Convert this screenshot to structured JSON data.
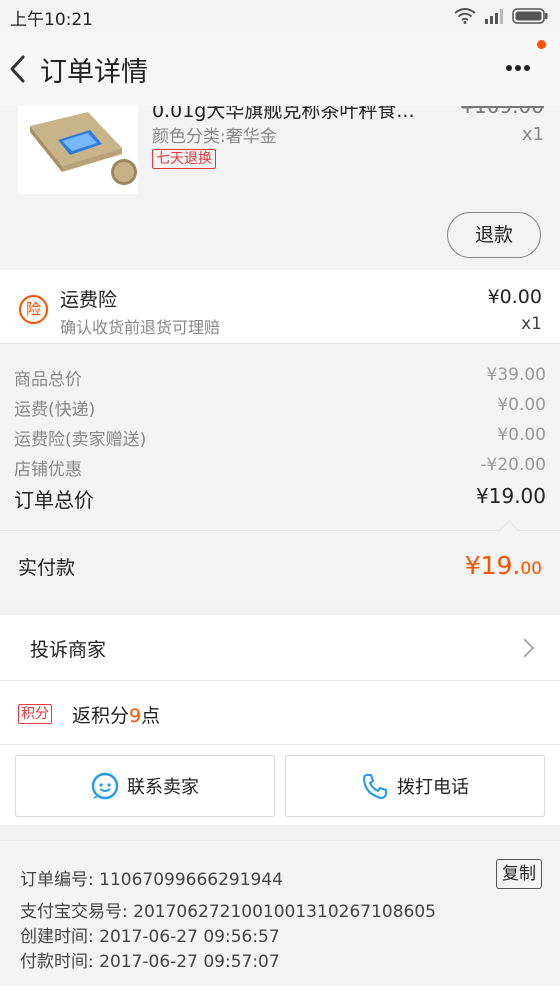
{
  "status_bar": {
    "time": "上午10:21"
  },
  "nav": {
    "title": "订单详情"
  },
  "product": {
    "title": "0.01g大华旗舰克称茶叶秤食...",
    "old_price": "¥109.00",
    "sku": "颜色分类:奢华金",
    "qty": "x1",
    "badge": "七天退换",
    "refund_label": "退款"
  },
  "insurance": {
    "icon_text": "险",
    "title": "运费险",
    "desc": "确认收货前退货可理赔",
    "price": "¥0.00",
    "qty": "x1"
  },
  "summary": {
    "rows": [
      {
        "label": "商品总价",
        "value": "¥39.00"
      },
      {
        "label": "运费(快递)",
        "value": "¥0.00"
      },
      {
        "label": "运费险(卖家赠送)",
        "value": "¥0.00"
      },
      {
        "label": "店铺优惠",
        "value": "-¥20.00"
      }
    ],
    "total_label": "订单总价",
    "total_value": "¥19.00"
  },
  "paid": {
    "label": "实付款",
    "amount_int": "¥19.",
    "amount_dec": "00"
  },
  "complain": {
    "label": "投诉商家"
  },
  "points": {
    "badge": "积分",
    "prefix": "返积分",
    "number": "9",
    "suffix": "点"
  },
  "actions": {
    "contact_label": "联系卖家",
    "call_label": "拨打电话"
  },
  "order_info": {
    "order_no": "订单编号: 11067099666291944",
    "alipay_no": "支付宝交易号: 2017062721001001310267108605",
    "created": "创建时间: 2017-06-27 09:56:57",
    "paid": "付款时间: 2017-06-27 09:57:07",
    "copy_label": "复制"
  },
  "colors": {
    "accent": "#ff5000",
    "badge_red": "#e4393c"
  }
}
